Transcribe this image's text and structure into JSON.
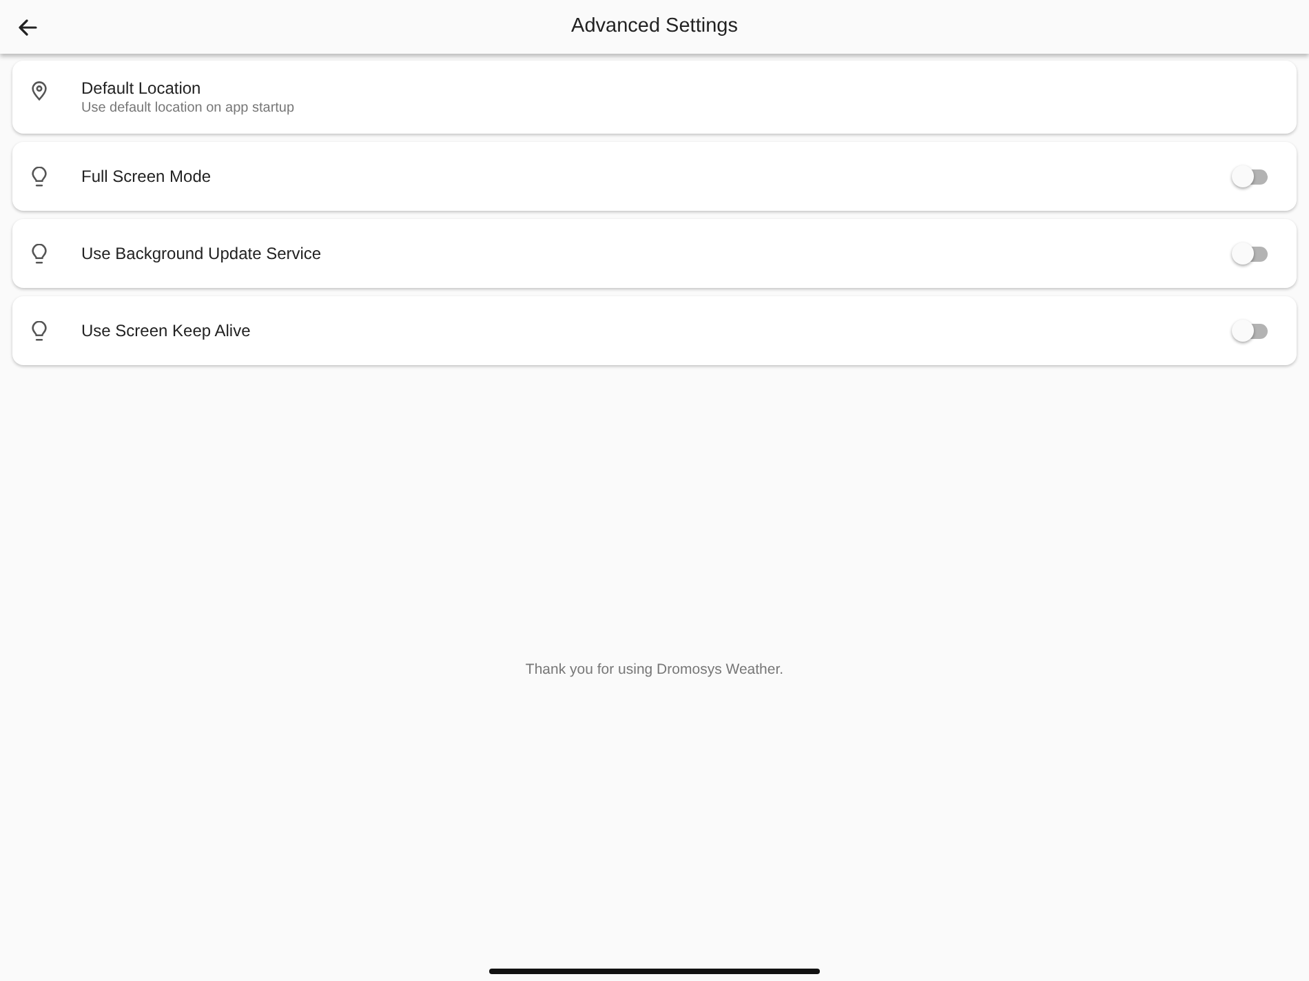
{
  "app_bar": {
    "title": "Advanced Settings"
  },
  "settings": [
    {
      "kind": "link",
      "label": "Default Location",
      "subtitle": "Use default location on app startup"
    },
    {
      "kind": "switch",
      "label": "Full Screen Mode",
      "on": false
    },
    {
      "kind": "switch",
      "label": "Use Background Update Service",
      "on": false
    },
    {
      "kind": "switch",
      "label": "Use Screen Keep Alive",
      "on": false
    }
  ],
  "footer": {
    "text": "Thank you for using Dromosys Weather."
  }
}
